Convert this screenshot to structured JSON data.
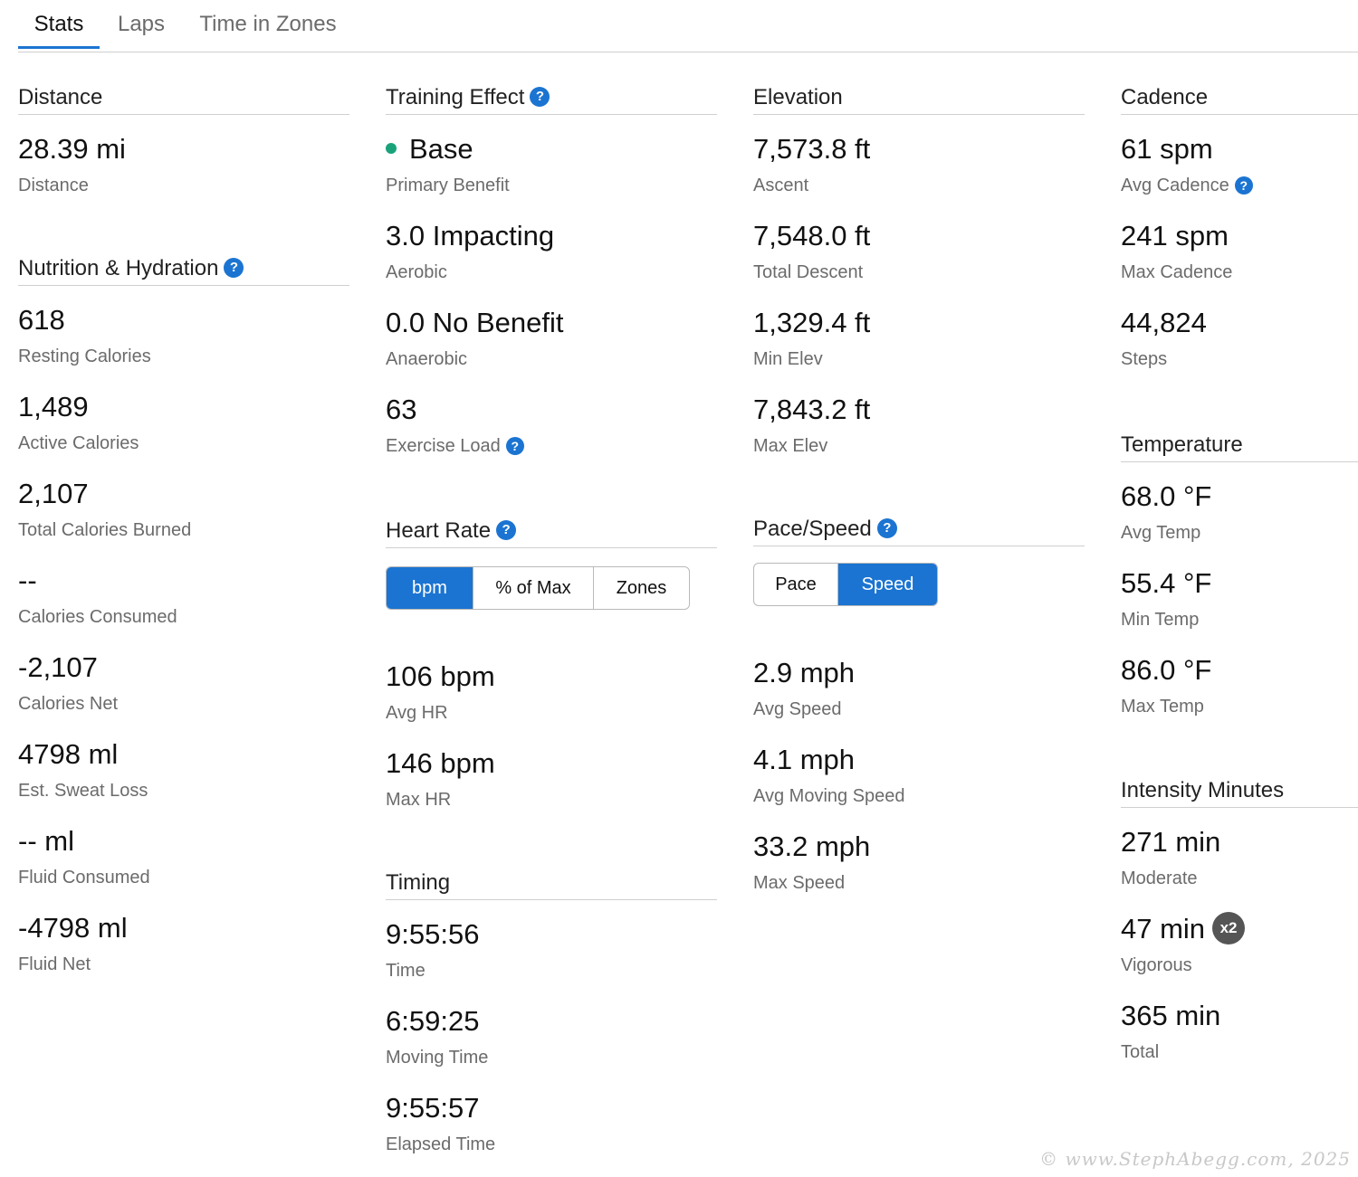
{
  "tabs": [
    "Stats",
    "Laps",
    "Time in Zones"
  ],
  "help_glyph": "?",
  "distance": {
    "title": "Distance",
    "items": [
      {
        "value": "28.39 mi",
        "label": "Distance"
      }
    ]
  },
  "nutrition": {
    "title": "Nutrition & Hydration",
    "items": [
      {
        "value": "618",
        "label": "Resting Calories"
      },
      {
        "value": "1,489",
        "label": "Active Calories"
      },
      {
        "value": "2,107",
        "label": "Total Calories Burned"
      },
      {
        "value": "--",
        "label": "Calories Consumed"
      },
      {
        "value": "-2,107",
        "label": "Calories Net"
      },
      {
        "value": "4798 ml",
        "label": "Est. Sweat Loss"
      },
      {
        "value": "-- ml",
        "label": "Fluid Consumed"
      },
      {
        "value": "-4798 ml",
        "label": "Fluid Net"
      }
    ]
  },
  "training": {
    "title": "Training Effect",
    "status_color": "#1aa37a",
    "items": [
      {
        "value": "Base",
        "label": "Primary Benefit"
      },
      {
        "value": "3.0 Impacting",
        "label": "Aerobic"
      },
      {
        "value": "0.0 No Benefit",
        "label": "Anaerobic"
      },
      {
        "value": "63",
        "label": "Exercise Load"
      }
    ]
  },
  "heart_rate": {
    "title": "Heart Rate",
    "options": [
      "bpm",
      "% of Max",
      "Zones"
    ],
    "selected": "bpm",
    "items": [
      {
        "value": "106 bpm",
        "label": "Avg HR"
      },
      {
        "value": "146 bpm",
        "label": "Max HR"
      }
    ]
  },
  "timing": {
    "title": "Timing",
    "items": [
      {
        "value": "9:55:56",
        "label": "Time"
      },
      {
        "value": "6:59:25",
        "label": "Moving Time"
      },
      {
        "value": "9:55:57",
        "label": "Elapsed Time"
      }
    ]
  },
  "elevation": {
    "title": "Elevation",
    "items": [
      {
        "value": "7,573.8 ft",
        "label": "Ascent"
      },
      {
        "value": "7,548.0 ft",
        "label": "Total Descent"
      },
      {
        "value": "1,329.4 ft",
        "label": "Min Elev"
      },
      {
        "value": "7,843.2 ft",
        "label": "Max Elev"
      }
    ]
  },
  "pace_speed": {
    "title": "Pace/Speed",
    "options": [
      "Pace",
      "Speed"
    ],
    "selected": "Speed",
    "items": [
      {
        "value": "2.9 mph",
        "label": "Avg Speed"
      },
      {
        "value": "4.1 mph",
        "label": "Avg Moving Speed"
      },
      {
        "value": "33.2 mph",
        "label": "Max Speed"
      }
    ]
  },
  "cadence": {
    "title": "Cadence",
    "items": [
      {
        "value": "61 spm",
        "label": "Avg Cadence"
      },
      {
        "value": "241 spm",
        "label": "Max Cadence"
      },
      {
        "value": "44,824",
        "label": "Steps"
      }
    ]
  },
  "temperature": {
    "title": "Temperature",
    "items": [
      {
        "value": "68.0 °F",
        "label": "Avg Temp"
      },
      {
        "value": "55.4 °F",
        "label": "Min Temp"
      },
      {
        "value": "86.0 °F",
        "label": "Max Temp"
      }
    ]
  },
  "intensity": {
    "title": "Intensity Minutes",
    "vigorous_badge": "x2",
    "items": [
      {
        "value": "271 min",
        "label": "Moderate"
      },
      {
        "value": "47 min",
        "label": "Vigorous"
      },
      {
        "value": "365 min",
        "label": "Total"
      }
    ]
  },
  "colors": {
    "accent": "#1b74d1",
    "badge": "#555555"
  },
  "watermark": "© www.StephAbegg.com, 2025"
}
